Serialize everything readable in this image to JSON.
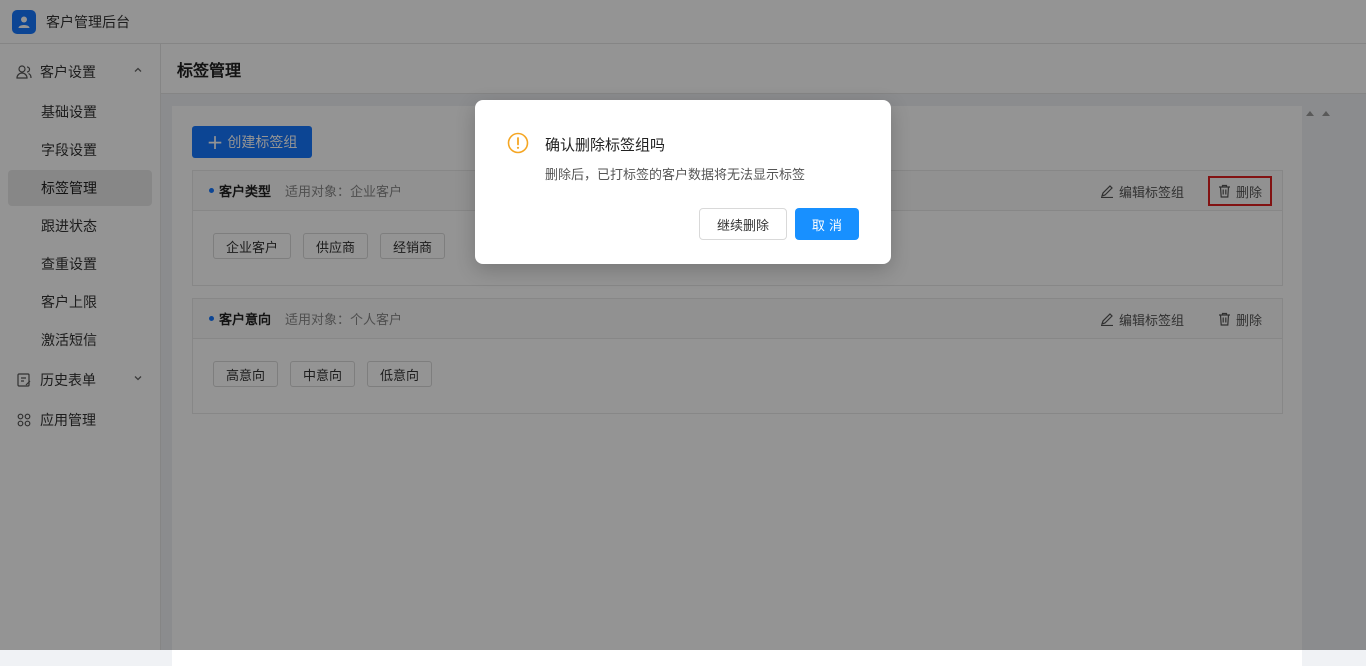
{
  "app": {
    "title": "客户管理后台",
    "logo_icon": "user-icon",
    "accent": "#1677ff"
  },
  "sidebar": {
    "groups": [
      {
        "label": "客户设置",
        "icon": "users-icon",
        "expanded": true,
        "items": [
          {
            "label": "基础设置"
          },
          {
            "label": "字段设置"
          },
          {
            "label": "标签管理",
            "active": true
          },
          {
            "label": "跟进状态"
          },
          {
            "label": "查重设置"
          },
          {
            "label": "客户上限"
          },
          {
            "label": "激活短信"
          }
        ]
      },
      {
        "label": "历史表单",
        "icon": "form-edit-icon",
        "expanded": false
      },
      {
        "label": "应用管理",
        "icon": "apps-icon"
      }
    ]
  },
  "page": {
    "title": "标签管理",
    "create_button": "创建标签组"
  },
  "tag_groups": [
    {
      "name": "客户类型",
      "applies_to": "适用对象：企业客户",
      "edit_label": "编辑标签组",
      "delete_label": "删除",
      "tags": [
        "企业客户",
        "供应商",
        "经销商"
      ]
    },
    {
      "name": "客户意向",
      "applies_to": "适用对象：个人客户",
      "edit_label": "编辑标签组",
      "delete_label": "删除",
      "tags": [
        "高意向",
        "中意向",
        "低意向"
      ]
    }
  ],
  "dialog": {
    "title": "确认删除标签组吗",
    "message": "删除后，已打标签的客户数据将无法显示标签",
    "continue_label": "继续删除",
    "cancel_label": "取 消",
    "icon": "warning-icon",
    "icon_color": "#f5a623"
  }
}
